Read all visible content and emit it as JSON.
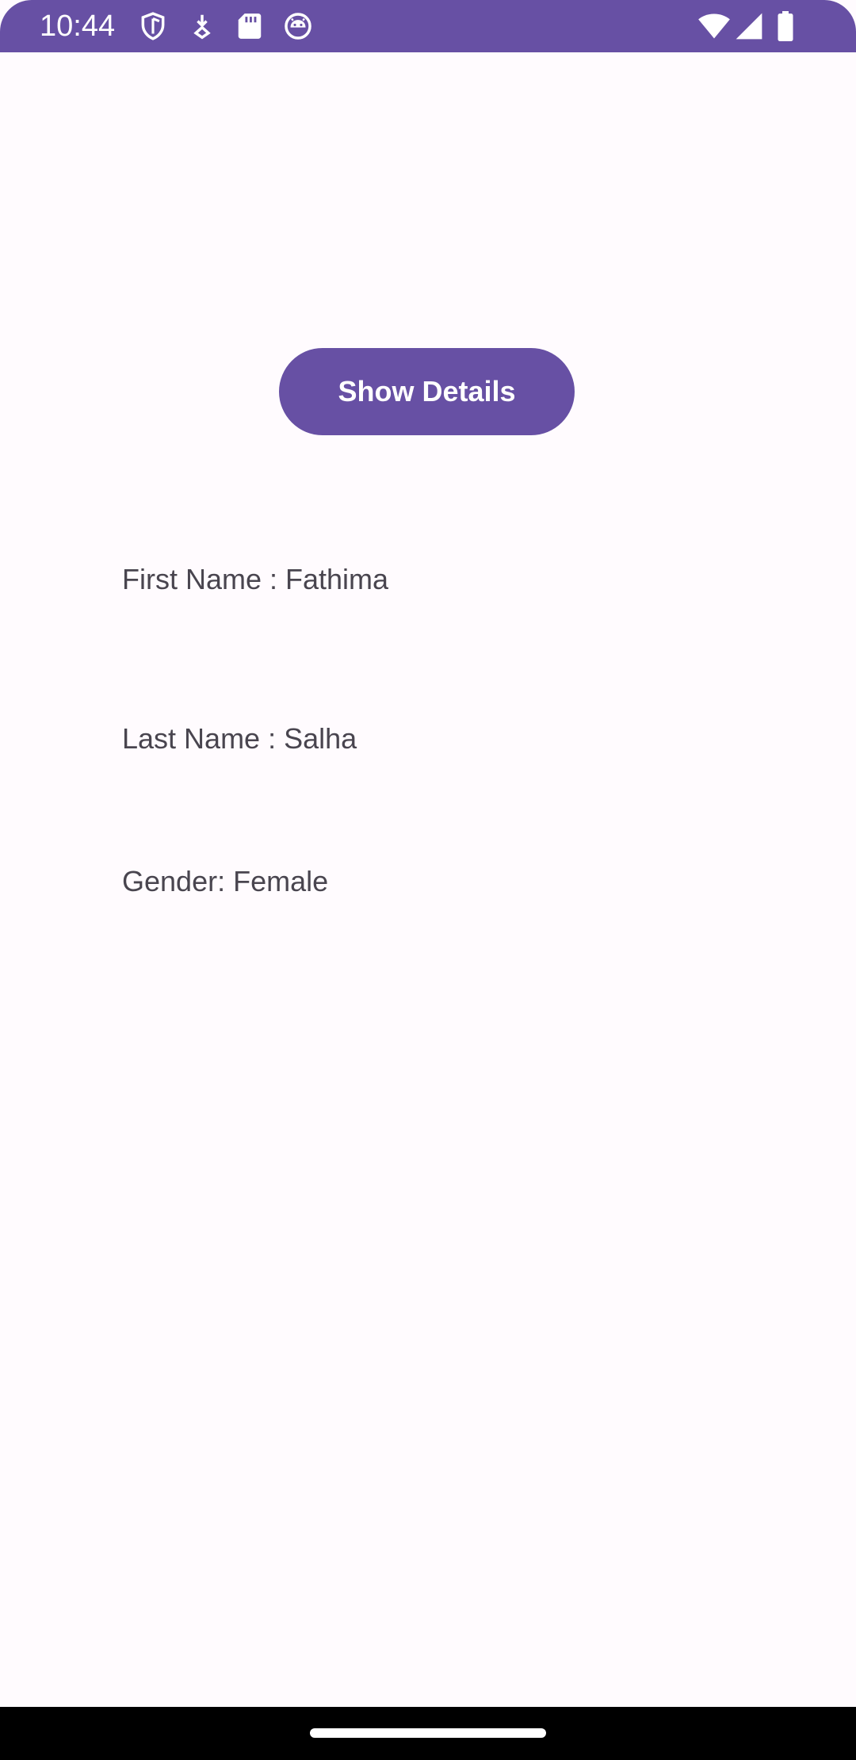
{
  "status_bar": {
    "time": "10:44",
    "background_color": "#6750a4",
    "left_icons": [
      "shield-icon",
      "download-icon",
      "sd-card-icon",
      "android-face-icon"
    ],
    "right_icons": [
      "wifi-icon",
      "signal-icon",
      "battery-icon"
    ]
  },
  "main": {
    "show_details_label": "Show Details",
    "first_name_text": "First Name : Fathima",
    "last_name_text": "Last Name : Salha",
    "gender_text": "Gender: Female"
  },
  "theme": {
    "accent": "#6750a4",
    "background": "#fffbfe",
    "text": "#49454f"
  },
  "nav_bar": {
    "background_color": "#000000"
  }
}
